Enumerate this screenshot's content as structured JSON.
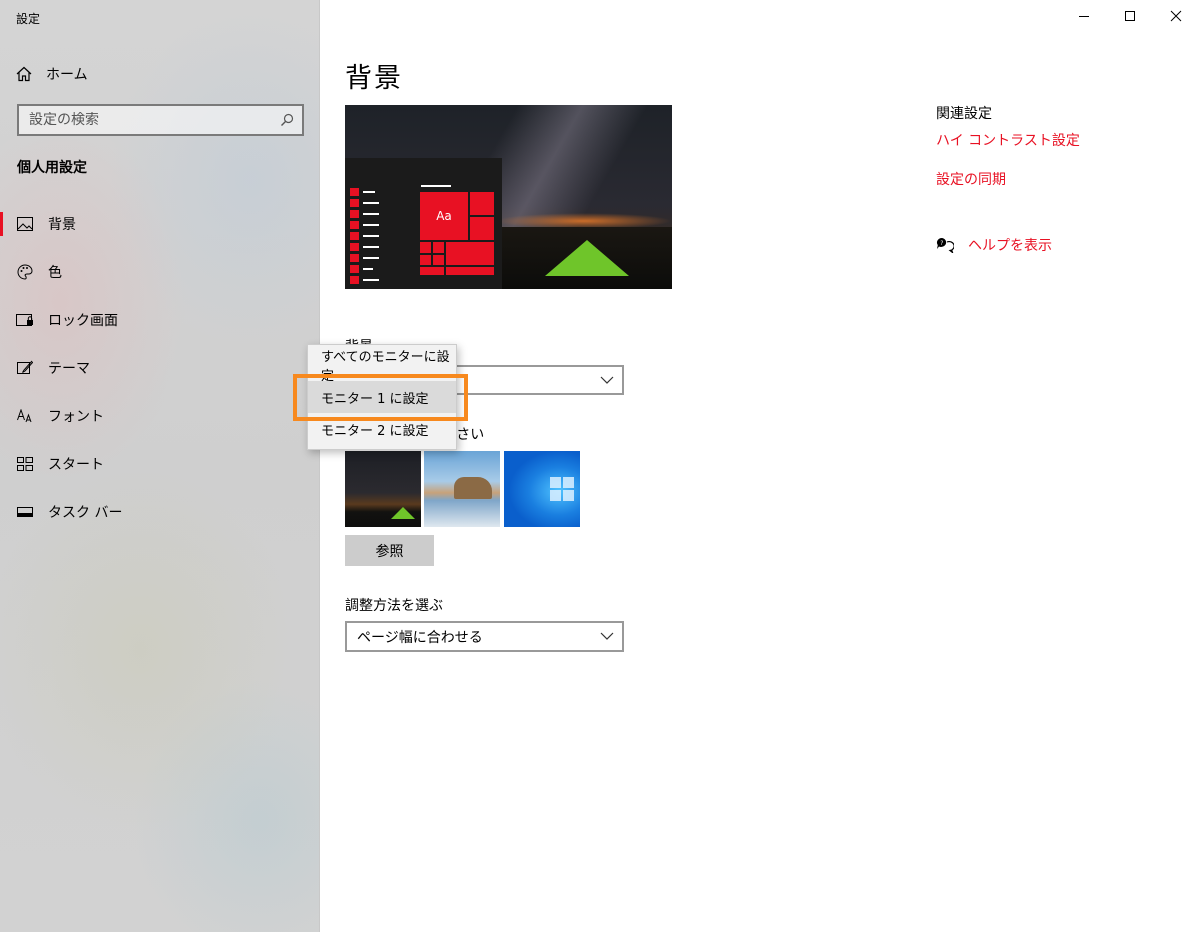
{
  "window": {
    "title": "設定"
  },
  "sidebar": {
    "home_label": "ホーム",
    "search_placeholder": "設定の検索",
    "section_title": "個人用設定",
    "items": [
      {
        "label": "背景",
        "icon": "picture-icon",
        "active": true
      },
      {
        "label": "色",
        "icon": "palette-icon",
        "active": false
      },
      {
        "label": "ロック画面",
        "icon": "lock-screen-icon",
        "active": false
      },
      {
        "label": "テーマ",
        "icon": "theme-brush-icon",
        "active": false
      },
      {
        "label": "フォント",
        "icon": "font-icon",
        "active": false
      },
      {
        "label": "スタート",
        "icon": "start-grid-icon",
        "active": false
      },
      {
        "label": "タスク バー",
        "icon": "taskbar-icon",
        "active": false
      }
    ]
  },
  "main": {
    "title": "背景",
    "preview": {
      "tile_text": "Aa"
    },
    "background_label": "背景",
    "picture_label": "画像を選んでください",
    "browse_label": "参照",
    "fit_label": "調整方法を選ぶ",
    "fit_value": "ページ幅に合わせる"
  },
  "context_menu": {
    "items": [
      {
        "label": "すべてのモニターに設定",
        "selected": false
      },
      {
        "label": "モニター 1 に設定",
        "selected": true
      },
      {
        "label": "モニター 2 に設定",
        "selected": false
      }
    ],
    "highlight_color": "#f7891e"
  },
  "related": {
    "title": "関連設定",
    "links": [
      "ハイ コントラスト設定",
      "設定の同期"
    ],
    "help_label": "ヘルプを表示"
  },
  "colors": {
    "accent": "#e81123"
  }
}
